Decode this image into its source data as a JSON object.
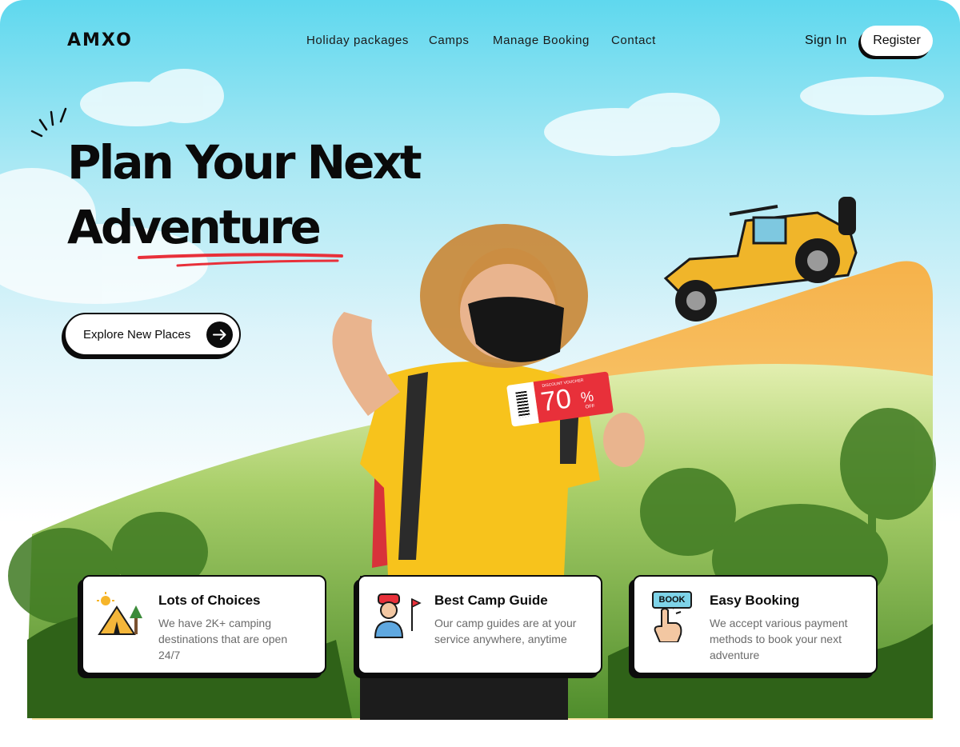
{
  "brand": {
    "logo": "AMXO"
  },
  "nav": {
    "items": [
      "Holiday packages",
      "Camps",
      "Manage Booking",
      "Contact"
    ],
    "sign_in": "Sign In",
    "register": "Register"
  },
  "hero": {
    "headline_line1": "Plan Your Next",
    "headline_line2": "Adventure",
    "cta_label": "Explore New Places",
    "voucher": {
      "small_text": "DISCOUNT VOUCHER",
      "value": "70",
      "unit": "%",
      "suffix": "OFF"
    }
  },
  "features": [
    {
      "title": "Lots of Choices",
      "text": "We have 2K+ camping destinations that are open 24/7",
      "icon": "tent-icon"
    },
    {
      "title": "Best Camp Guide",
      "text": "Our camp guides are at your service anywhere, anytime",
      "icon": "camp-guide-icon"
    },
    {
      "title": "Easy Booking",
      "text": "We accept various payment methods to book your next adventure",
      "icon": "book-tap-icon",
      "icon_label": "BOOK"
    }
  ],
  "colors": {
    "sky_top": "#5fd8ee",
    "accent_red": "#e8303a",
    "jeep_yellow": "#f0b52a",
    "shirt_yellow": "#f7c31c",
    "forest_dark": "#356a1f",
    "ink": "#0c0c0c"
  }
}
